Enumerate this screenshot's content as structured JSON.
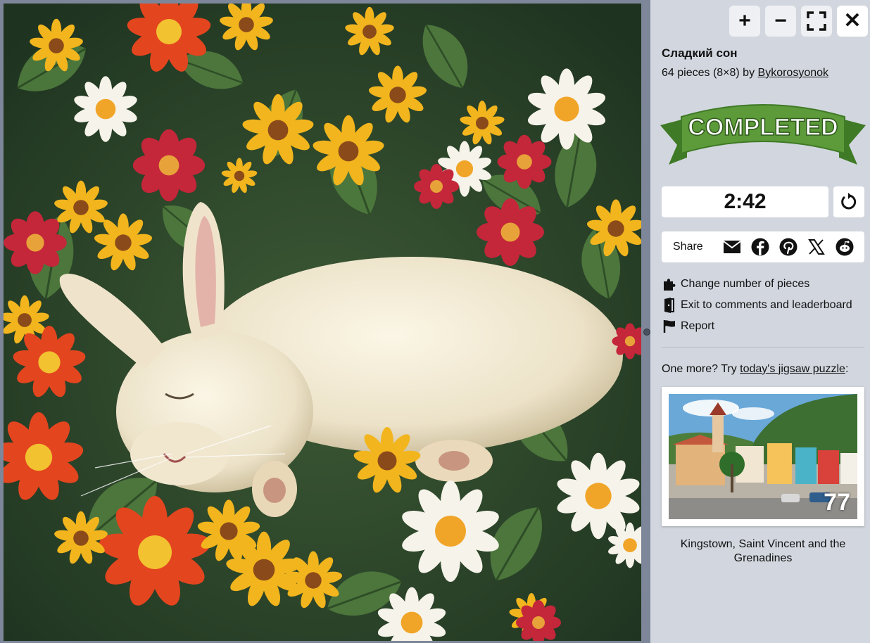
{
  "toolbar": {
    "zoom_in": "+",
    "zoom_out": "−",
    "close": "✕"
  },
  "puzzle": {
    "title": "Сладкий сон",
    "pieces_text": "64 pieces (8×8) by ",
    "author": "Bykorosyonok",
    "status_banner": "COMPLETED",
    "timer": "2:42"
  },
  "share": {
    "label": "Share",
    "icons": [
      "email-icon",
      "facebook-icon",
      "pinterest-icon",
      "x-icon",
      "reddit-icon"
    ]
  },
  "menu": {
    "change_pieces": "Change number of pieces",
    "exit": "Exit to comments and leaderboard",
    "report": "Report"
  },
  "suggestion": {
    "prefix": "One more? Try ",
    "link": "today's jigsaw puzzle",
    "suffix": ":",
    "number": "77",
    "caption": "Kingstown, Saint Vincent and the Grenadines"
  },
  "colors": {
    "panel_bg": "#d2d7df",
    "ribbon_green": "#5d9a3a",
    "ribbon_dark": "#3f7a26"
  }
}
